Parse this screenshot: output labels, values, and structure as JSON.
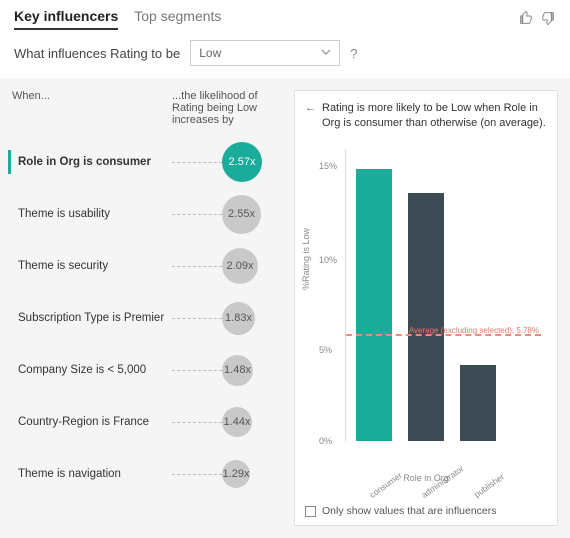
{
  "tabs": {
    "key_influencers": "Key influencers",
    "top_segments": "Top segments"
  },
  "question": {
    "prefix": "What influences Rating to be",
    "select_value": "Low",
    "help": "?"
  },
  "columns": {
    "when": "When...",
    "likelihood": "...the likelihood of Rating being Low increases by"
  },
  "influencers": [
    {
      "label": "Role in Org is consumer",
      "value": "2.57x",
      "selected": true
    },
    {
      "label": "Theme is usability",
      "value": "2.55x"
    },
    {
      "label": "Theme is security",
      "value": "2.09x"
    },
    {
      "label": "Subscription Type is Premier",
      "value": "1.83x"
    },
    {
      "label": "Company Size is < 5,000",
      "value": "1.48x"
    },
    {
      "label": "Country-Region is France",
      "value": "1.44x"
    },
    {
      "label": "Theme is navigation",
      "value": "1.29x"
    }
  ],
  "insight": {
    "back": "←",
    "text": "Rating is more likely to be Low when Role in Org is consumer than otherwise (on average)."
  },
  "chart_data": {
    "type": "bar",
    "categories": [
      "consumer",
      "administrator",
      "publisher"
    ],
    "values": [
      14.9,
      13.6,
      4.1
    ],
    "selected_index": 0,
    "title": "",
    "xlabel": "Role in Org",
    "ylabel": "%Rating is Low",
    "ylim": [
      0,
      16
    ],
    "yticks": [
      0,
      5,
      10,
      15
    ],
    "ytick_labels": [
      "0%",
      "5%",
      "10%",
      "15%"
    ],
    "average_line": {
      "value": 5.78,
      "label": "Average (excluding selected): 5.78%"
    }
  },
  "footer": {
    "only_influencers": "Only show values that are influencers"
  }
}
